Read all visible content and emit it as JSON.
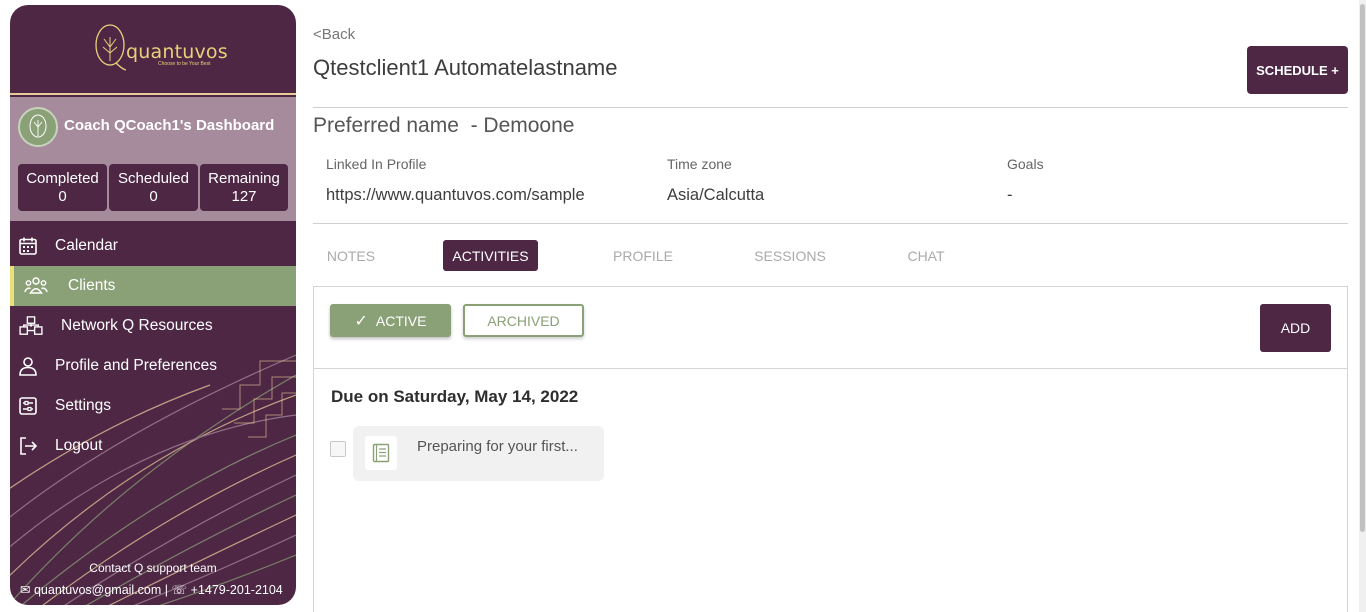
{
  "sidebar": {
    "logo_text": "quantuvos",
    "logo_tagline": "Choose to be Your Best",
    "coach_title": "Coach QCoach1's Dashboard",
    "stats": [
      {
        "label": "Completed",
        "value": "0"
      },
      {
        "label": "Scheduled",
        "value": "0"
      },
      {
        "label": "Remaining",
        "value": "127"
      }
    ],
    "nav": [
      {
        "label": "Calendar",
        "icon": "calendar-icon"
      },
      {
        "label": "Clients",
        "icon": "users-icon",
        "active": true
      },
      {
        "label": "Network Q Resources",
        "icon": "network-icon"
      },
      {
        "label": "Profile and Preferences",
        "icon": "user-icon"
      },
      {
        "label": "Settings",
        "icon": "settings-icon"
      },
      {
        "label": "Logout",
        "icon": "logout-icon"
      }
    ],
    "support_title": "Contact Q support team",
    "support_email": "quantuvos@gmail.com",
    "support_phone": "+1479-201-2104"
  },
  "header": {
    "back_label": "<Back",
    "client_name": "Qtestclient1 Automatelastname",
    "schedule_label": "SCHEDULE +",
    "preferred_name": "Preferred name  - Demoone"
  },
  "info": {
    "linkedin_label": "Linked In Profile",
    "linkedin_value": "https://www.quantuvos.com/sample",
    "timezone_label": "Time zone",
    "timezone_value": "Asia/Calcutta",
    "goals_label": "Goals",
    "goals_value": "-"
  },
  "tabs": [
    {
      "label": "NOTES"
    },
    {
      "label": "ACTIVITIES",
      "active": true
    },
    {
      "label": "PROFILE"
    },
    {
      "label": "SESSIONS"
    },
    {
      "label": "CHAT"
    }
  ],
  "activities": {
    "active_label": "ACTIVE",
    "archived_label": "ARCHIVED",
    "add_label": "ADD",
    "due_heading": "Due on Saturday, May 14, 2022",
    "items": [
      {
        "title": "Preparing for your first...",
        "icon": "book-icon",
        "checked": false
      }
    ]
  },
  "colors": {
    "primary": "#4e2745",
    "accent": "#8aa076",
    "highlight": "#e9e07a"
  }
}
